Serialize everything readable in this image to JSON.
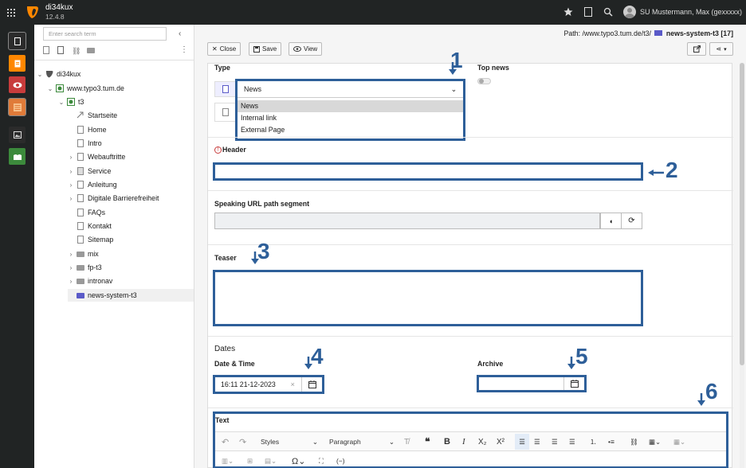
{
  "topbar": {
    "site_name": "di34kux",
    "version": "12.4.8",
    "user": "SU Mustermann, Max (gexxxxx)"
  },
  "tree": {
    "search_placeholder": "Enter search term",
    "nodes": [
      {
        "label": "di34kux"
      },
      {
        "label": "www.typo3.tum.de"
      },
      {
        "label": "t3"
      },
      {
        "label": "Startseite"
      },
      {
        "label": "Home"
      },
      {
        "label": "Intro"
      },
      {
        "label": "Webauftritte"
      },
      {
        "label": "Service"
      },
      {
        "label": "Anleitung"
      },
      {
        "label": "Digitale Barrierefreiheit"
      },
      {
        "label": "FAQs"
      },
      {
        "label": "Kontakt"
      },
      {
        "label": "Sitemap"
      },
      {
        "label": "mix"
      },
      {
        "label": "fp-t3"
      },
      {
        "label": "intronav"
      },
      {
        "label": "news-system-t3"
      }
    ]
  },
  "path": {
    "prefix": "Path: /www.typo3.tum.de/t3/",
    "page": "news-system-t3 [17]"
  },
  "toolbar": {
    "close": "Close",
    "save": "Save",
    "view": "View"
  },
  "form": {
    "type_label": "Type",
    "type_value": "News",
    "type_options": [
      "News",
      "Internal link",
      "External Page"
    ],
    "top_news_label": "Top news",
    "header_label": "Header",
    "speaking_url_label": "Speaking URL path segment",
    "teaser_label": "Teaser",
    "dates_heading": "Dates",
    "datetime_label": "Date & Time",
    "datetime_value": "16:11 21-12-2023",
    "archive_label": "Archive",
    "text_label": "Text",
    "rte_styles": "Styles",
    "rte_paragraph": "Paragraph"
  },
  "annotations": [
    "1",
    "2",
    "3",
    "4",
    "5",
    "6"
  ],
  "colors": {
    "annotation": "#2e5f99",
    "topbar": "#212424",
    "brand_orange": "#ff8700"
  }
}
